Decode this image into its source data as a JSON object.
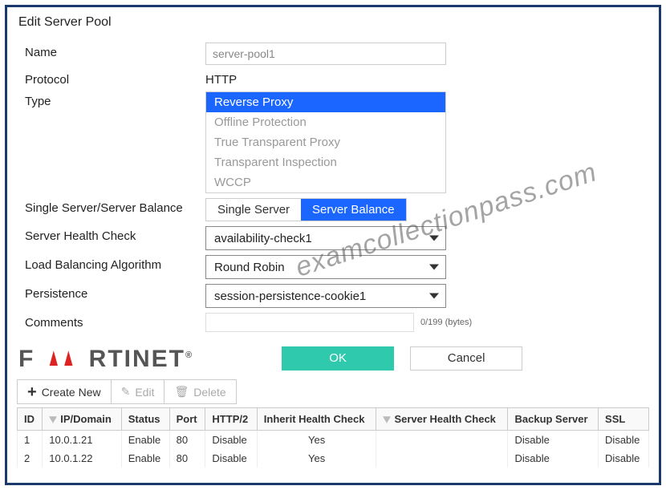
{
  "title": "Edit Server Pool",
  "form": {
    "name_label": "Name",
    "name_value": "server-pool1",
    "protocol_label": "Protocol",
    "protocol_value": "HTTP",
    "type_label": "Type",
    "type_options": [
      {
        "label": "Reverse Proxy",
        "selected": true
      },
      {
        "label": "Offline Protection",
        "selected": false
      },
      {
        "label": "True Transparent Proxy",
        "selected": false
      },
      {
        "label": "Transparent Inspection",
        "selected": false
      },
      {
        "label": "WCCP",
        "selected": false
      }
    ],
    "balance_label": "Single Server/Server Balance",
    "balance_options": [
      {
        "label": "Single Server",
        "selected": false
      },
      {
        "label": "Server Balance",
        "selected": true
      }
    ],
    "healthcheck_label": "Server Health Check",
    "healthcheck_value": "availability-check1",
    "algorithm_label": "Load Balancing Algorithm",
    "algorithm_value": "Round Robin",
    "persistence_label": "Persistence",
    "persistence_value": "session-persistence-cookie1",
    "comments_label": "Comments",
    "comments_counter": "0/199 (bytes)"
  },
  "actions": {
    "ok": "OK",
    "cancel": "Cancel"
  },
  "logo_text": "FORTINET",
  "toolbar": {
    "create": "Create New",
    "edit": "Edit",
    "delete": "Delete"
  },
  "table": {
    "headers": {
      "id": "ID",
      "ip": "IP/Domain",
      "status": "Status",
      "port": "Port",
      "http2": "HTTP/2",
      "inherit": "Inherit Health Check",
      "shc": "Server Health Check",
      "backup": "Backup Server",
      "ssl": "SSL"
    },
    "rows": [
      {
        "id": "1",
        "ip": "10.0.1.21",
        "status": "Enable",
        "port": "80",
        "http2": "Disable",
        "inherit": "Yes",
        "shc": "",
        "backup": "Disable",
        "ssl": "Disable"
      },
      {
        "id": "2",
        "ip": "10.0.1.22",
        "status": "Enable",
        "port": "80",
        "http2": "Disable",
        "inherit": "Yes",
        "shc": "",
        "backup": "Disable",
        "ssl": "Disable"
      }
    ]
  },
  "watermark": "examcollectionpass.com"
}
